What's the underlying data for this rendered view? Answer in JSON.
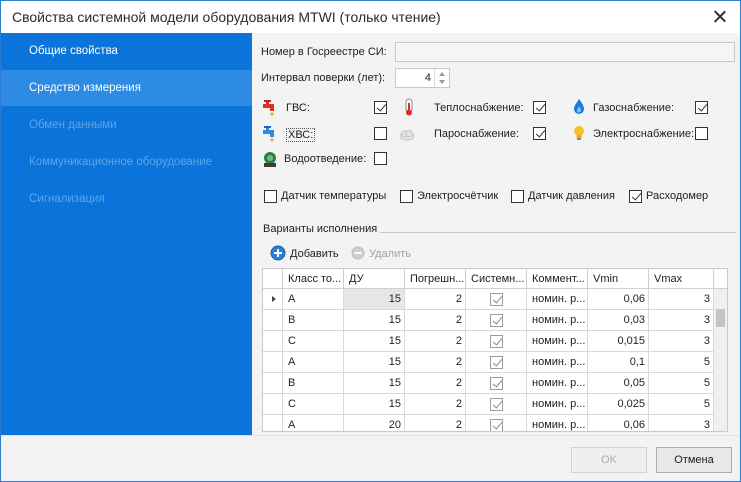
{
  "window": {
    "title": "Свойства системной модели оборудования MTWI (только чтение)"
  },
  "sidebar": {
    "items": [
      {
        "label": "Общие свойства",
        "state": "normal"
      },
      {
        "label": "Средство измерения",
        "state": "active"
      },
      {
        "label": "Обмен данными",
        "state": "disabled"
      },
      {
        "label": "Коммуникационное оборудование",
        "state": "disabled"
      },
      {
        "label": "Сигнализация",
        "state": "disabled"
      }
    ]
  },
  "form": {
    "registry_label": "Номер в Госреестре СИ:",
    "registry_value": "",
    "interval_label": "Интервал поверки (лет):",
    "interval_value": "4",
    "resources": [
      {
        "label": "ГВС:",
        "icon": "hot-water-tap-icon",
        "checked": true
      },
      {
        "label": "Теплоснабжение:",
        "icon": "thermometer-icon",
        "checked": true
      },
      {
        "label": "Газоснабжение:",
        "icon": "gas-flame-icon",
        "checked": true
      },
      {
        "label": "ХВС:",
        "icon": "cold-water-tap-icon",
        "checked": false
      },
      {
        "label": "Пароснабжение:",
        "icon": "steam-cloud-icon",
        "checked": true
      },
      {
        "label": "Электроснабжение:",
        "icon": "light-bulb-icon",
        "checked": false
      },
      {
        "label": "Водоотведение:",
        "icon": "drain-icon",
        "checked": false
      }
    ],
    "sensors": [
      {
        "label": "Датчик температуры",
        "checked": false
      },
      {
        "label": "Электросчётчик",
        "checked": false
      },
      {
        "label": "Датчик давления",
        "checked": false
      },
      {
        "label": "Расходомер",
        "checked": true
      }
    ]
  },
  "variants": {
    "title": "Варианты исполнения",
    "add_label": "Добавить",
    "delete_label": "Удалить",
    "columns": [
      "Класс то...",
      "ДУ",
      "Погрешн...",
      "Системн...",
      "Коммент...",
      "Vmin",
      "Vmax"
    ],
    "rows": [
      [
        "A",
        "15",
        "2",
        true,
        "номин. р...",
        "0,06",
        "3"
      ],
      [
        "B",
        "15",
        "2",
        true,
        "номин. р...",
        "0,03",
        "3"
      ],
      [
        "C",
        "15",
        "2",
        true,
        "номин. р...",
        "0,015",
        "3"
      ],
      [
        "A",
        "15",
        "2",
        true,
        "номин. р...",
        "0,1",
        "5"
      ],
      [
        "B",
        "15",
        "2",
        true,
        "номин. р...",
        "0,05",
        "5"
      ],
      [
        "C",
        "15",
        "2",
        true,
        "номин. р...",
        "0,025",
        "5"
      ],
      [
        "A",
        "20",
        "2",
        true,
        "номин. р...",
        "0,06",
        "3"
      ]
    ]
  },
  "footer": {
    "ok_label": "OK",
    "cancel_label": "Отмена"
  }
}
